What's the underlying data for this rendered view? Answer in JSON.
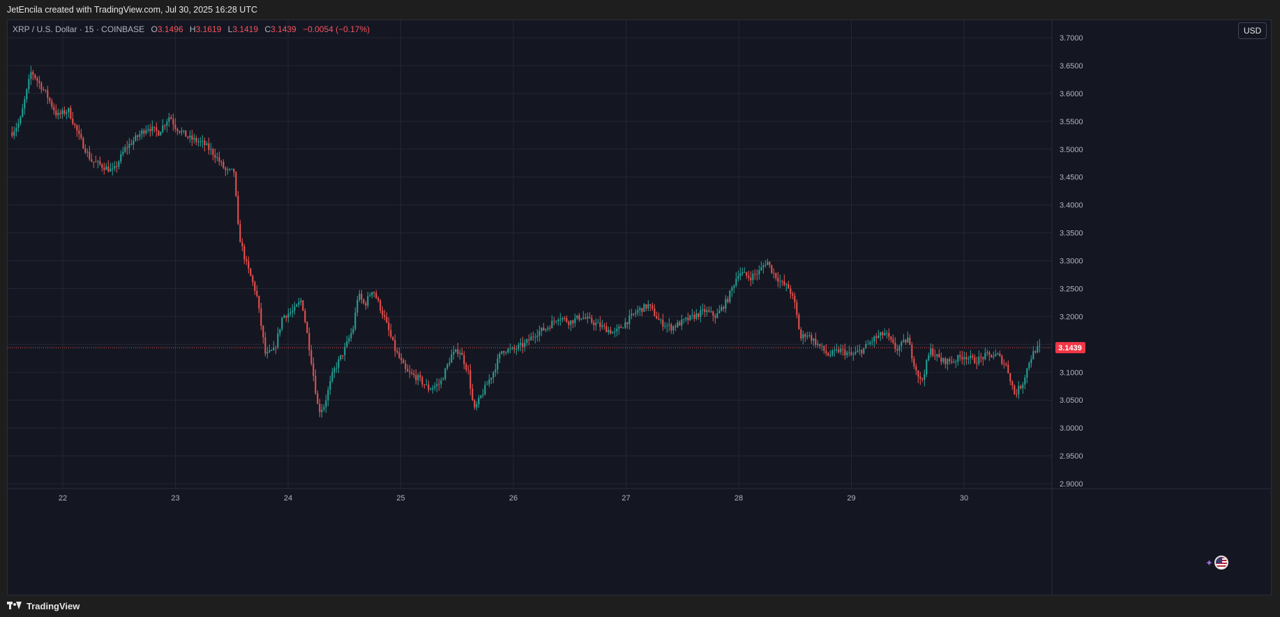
{
  "header": {
    "credit": "JetEncila created with TradingView.com, Jul 30, 2025 16:28 UTC"
  },
  "legend": {
    "symbol": "XRP / U.S. Dollar · 15 · COINBASE",
    "o_label": "O",
    "o_value": "3.1496",
    "h_label": "H",
    "h_value": "3.1619",
    "l_label": "L",
    "l_value": "3.1419",
    "c_label": "C",
    "c_value": "3.1439",
    "change": "−0.0054 (−0.17%)"
  },
  "currency_button": "USD",
  "footer": {
    "brand": "TradingView"
  },
  "icons": [
    "sparkle-icon",
    "us-flag-icon",
    "tradingview-logo-icon"
  ],
  "colors": {
    "up": "#26a69a",
    "down": "#ef5350",
    "background": "#141722",
    "grid": "#242733",
    "price_tag": "#f23645",
    "text": "#b2b5be"
  },
  "chart_data": {
    "type": "candlestick",
    "title": "XRP / U.S. Dollar · 15 · COINBASE",
    "interval": "15",
    "last_price": 3.1439,
    "last_price_label": "3.1439",
    "currency": "USD",
    "x_tick_labels": [
      "22",
      "23",
      "24",
      "25",
      "26",
      "27",
      "28",
      "29",
      "30"
    ],
    "y_tick_labels": [
      "3.7000",
      "3.6500",
      "3.6000",
      "3.5500",
      "3.5000",
      "3.4500",
      "3.4000",
      "3.3500",
      "3.3000",
      "3.2500",
      "3.2000",
      "3.1500",
      "3.1000",
      "3.0500",
      "3.0000",
      "2.9500",
      "2.9000"
    ],
    "ylim": [
      2.9,
      3.7
    ],
    "grid": true,
    "x_unit": "day of month (July 2025)",
    "price_path": [
      [
        21.55,
        3.53
      ],
      [
        21.62,
        3.55
      ],
      [
        21.72,
        3.64
      ],
      [
        21.85,
        3.6
      ],
      [
        21.95,
        3.56
      ],
      [
        22.05,
        3.57
      ],
      [
        22.15,
        3.52
      ],
      [
        22.25,
        3.48
      ],
      [
        22.35,
        3.47
      ],
      [
        22.45,
        3.46
      ],
      [
        22.55,
        3.5
      ],
      [
        22.65,
        3.52
      ],
      [
        22.75,
        3.54
      ],
      [
        22.85,
        3.53
      ],
      [
        22.95,
        3.56
      ],
      [
        23.0,
        3.54
      ],
      [
        23.12,
        3.52
      ],
      [
        23.25,
        3.51
      ],
      [
        23.35,
        3.49
      ],
      [
        23.45,
        3.46
      ],
      [
        23.52,
        3.46
      ],
      [
        23.56,
        3.35
      ],
      [
        23.62,
        3.3
      ],
      [
        23.72,
        3.24
      ],
      [
        23.8,
        3.13
      ],
      [
        23.88,
        3.14
      ],
      [
        23.95,
        3.2
      ],
      [
        24.05,
        3.21
      ],
      [
        24.12,
        3.23
      ],
      [
        24.2,
        3.13
      ],
      [
        24.27,
        3.03
      ],
      [
        24.32,
        3.04
      ],
      [
        24.4,
        3.1
      ],
      [
        24.5,
        3.14
      ],
      [
        24.58,
        3.18
      ],
      [
        24.62,
        3.24
      ],
      [
        24.68,
        3.22
      ],
      [
        24.75,
        3.25
      ],
      [
        24.85,
        3.2
      ],
      [
        24.95,
        3.14
      ],
      [
        25.05,
        3.1
      ],
      [
        25.15,
        3.09
      ],
      [
        25.25,
        3.07
      ],
      [
        25.35,
        3.08
      ],
      [
        25.45,
        3.13
      ],
      [
        25.52,
        3.14
      ],
      [
        25.6,
        3.1
      ],
      [
        25.65,
        3.03
      ],
      [
        25.72,
        3.06
      ],
      [
        25.82,
        3.1
      ],
      [
        25.9,
        3.14
      ],
      [
        26.0,
        3.14
      ],
      [
        26.1,
        3.15
      ],
      [
        26.2,
        3.17
      ],
      [
        26.3,
        3.18
      ],
      [
        26.4,
        3.2
      ],
      [
        26.5,
        3.19
      ],
      [
        26.6,
        3.2
      ],
      [
        26.7,
        3.19
      ],
      [
        26.8,
        3.18
      ],
      [
        26.9,
        3.17
      ],
      [
        27.0,
        3.19
      ],
      [
        27.1,
        3.21
      ],
      [
        27.2,
        3.22
      ],
      [
        27.3,
        3.19
      ],
      [
        27.4,
        3.18
      ],
      [
        27.5,
        3.19
      ],
      [
        27.6,
        3.2
      ],
      [
        27.7,
        3.21
      ],
      [
        27.8,
        3.2
      ],
      [
        27.9,
        3.23
      ],
      [
        28.0,
        3.28
      ],
      [
        28.1,
        3.27
      ],
      [
        28.18,
        3.28
      ],
      [
        28.25,
        3.3
      ],
      [
        28.3,
        3.28
      ],
      [
        28.38,
        3.26
      ],
      [
        28.45,
        3.25
      ],
      [
        28.5,
        3.22
      ],
      [
        28.55,
        3.16
      ],
      [
        28.6,
        3.17
      ],
      [
        28.7,
        3.15
      ],
      [
        28.8,
        3.13
      ],
      [
        28.9,
        3.14
      ],
      [
        29.0,
        3.13
      ],
      [
        29.1,
        3.14
      ],
      [
        29.2,
        3.16
      ],
      [
        29.3,
        3.17
      ],
      [
        29.4,
        3.14
      ],
      [
        29.5,
        3.16
      ],
      [
        29.55,
        3.12
      ],
      [
        29.62,
        3.08
      ],
      [
        29.7,
        3.14
      ],
      [
        29.8,
        3.12
      ],
      [
        29.9,
        3.12
      ],
      [
        30.0,
        3.13
      ],
      [
        30.1,
        3.12
      ],
      [
        30.2,
        3.13
      ],
      [
        30.3,
        3.13
      ],
      [
        30.38,
        3.11
      ],
      [
        30.45,
        3.06
      ],
      [
        30.52,
        3.08
      ],
      [
        30.58,
        3.12
      ],
      [
        30.63,
        3.14
      ],
      [
        30.68,
        3.144
      ]
    ]
  }
}
